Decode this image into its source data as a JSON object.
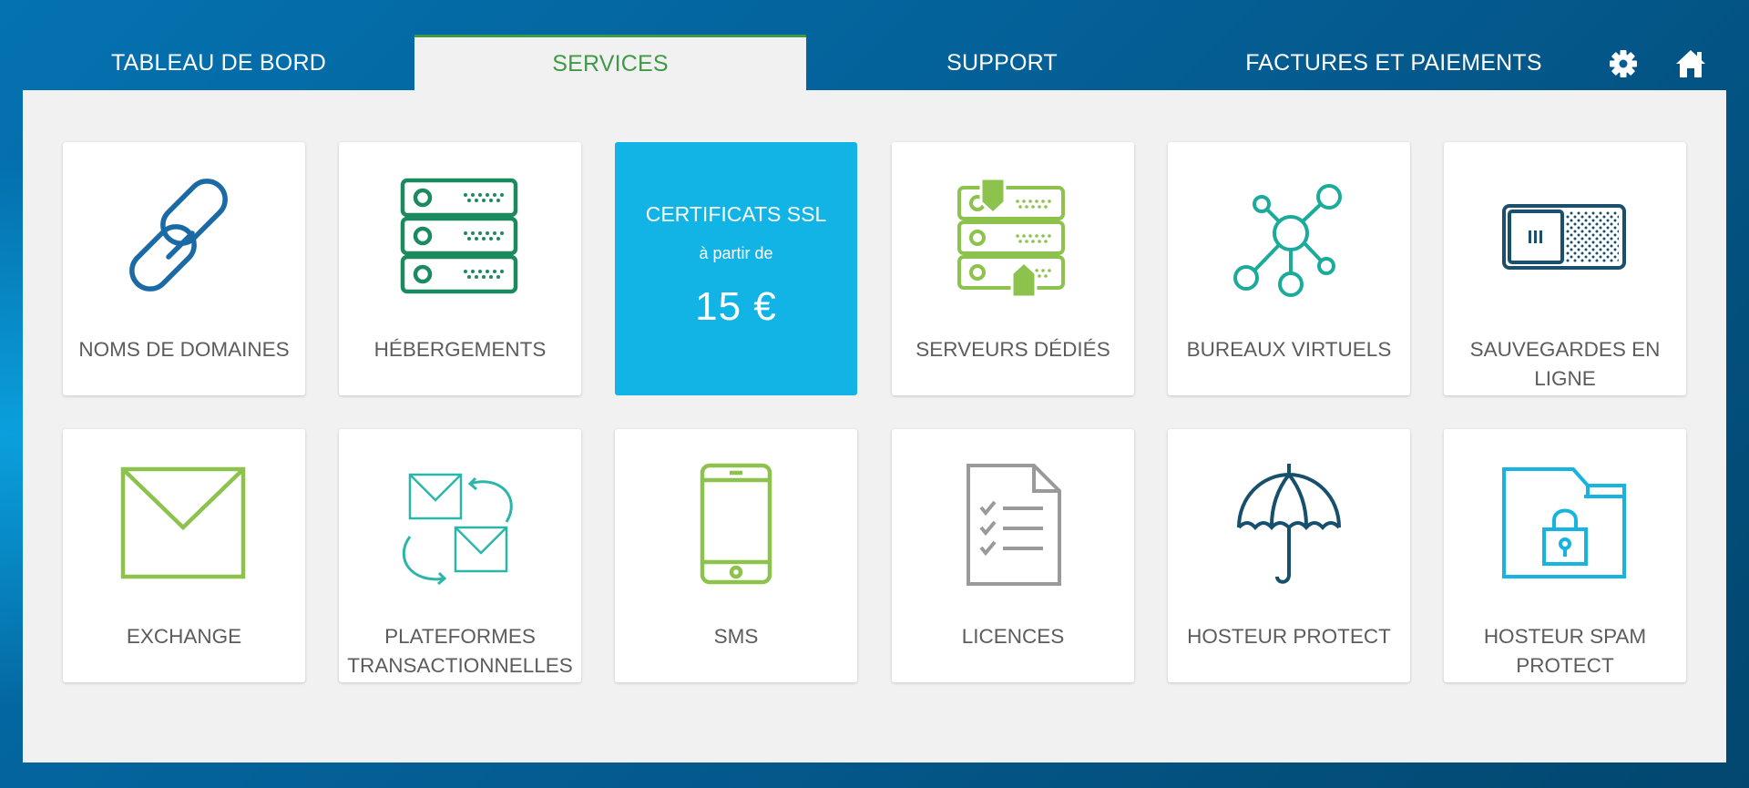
{
  "nav": {
    "tabs": [
      {
        "label": "TABLEAU DE BORD"
      },
      {
        "label": "SERVICES",
        "active": true
      },
      {
        "label": "SUPPORT"
      },
      {
        "label": "FACTURES ET PAIEMENTS"
      }
    ],
    "icons": [
      "gear-icon",
      "home-icon"
    ]
  },
  "colors": {
    "active_tab": "#3f9a45",
    "promo_bg": "#12b4e6",
    "panel_bg": "#f1f1f1"
  },
  "services": {
    "row1": [
      {
        "label": "NOMS DE DOMAINES",
        "icon": "link-icon"
      },
      {
        "label": "HÉBERGEMENTS",
        "icon": "server-stack-icon"
      },
      {
        "promo_title": "CERTIFICATS SSL",
        "promo_sub": "à partir de",
        "promo_price": "15 €"
      },
      {
        "label": "SERVEURS DÉDIÉS",
        "icon": "dedicated-server-icon"
      },
      {
        "label": "BUREAUX VIRTUELS",
        "icon": "network-icon"
      },
      {
        "label": "SAUVEGARDES EN LIGNE",
        "icon": "backup-drive-icon"
      }
    ],
    "row2": [
      {
        "label": "EXCHANGE",
        "icon": "envelope-icon"
      },
      {
        "label": "PLATEFORMES\nTRANSACTIONNELLES",
        "icon": "mail-exchange-icon"
      },
      {
        "label": "SMS",
        "icon": "phone-icon"
      },
      {
        "label": "LICENCES",
        "icon": "checklist-document-icon"
      },
      {
        "label": "HOSTEUR PROTECT",
        "icon": "umbrella-icon"
      },
      {
        "label": "HOSTEUR SPAM\nPROTECT",
        "icon": "locked-folder-icon"
      }
    ]
  }
}
